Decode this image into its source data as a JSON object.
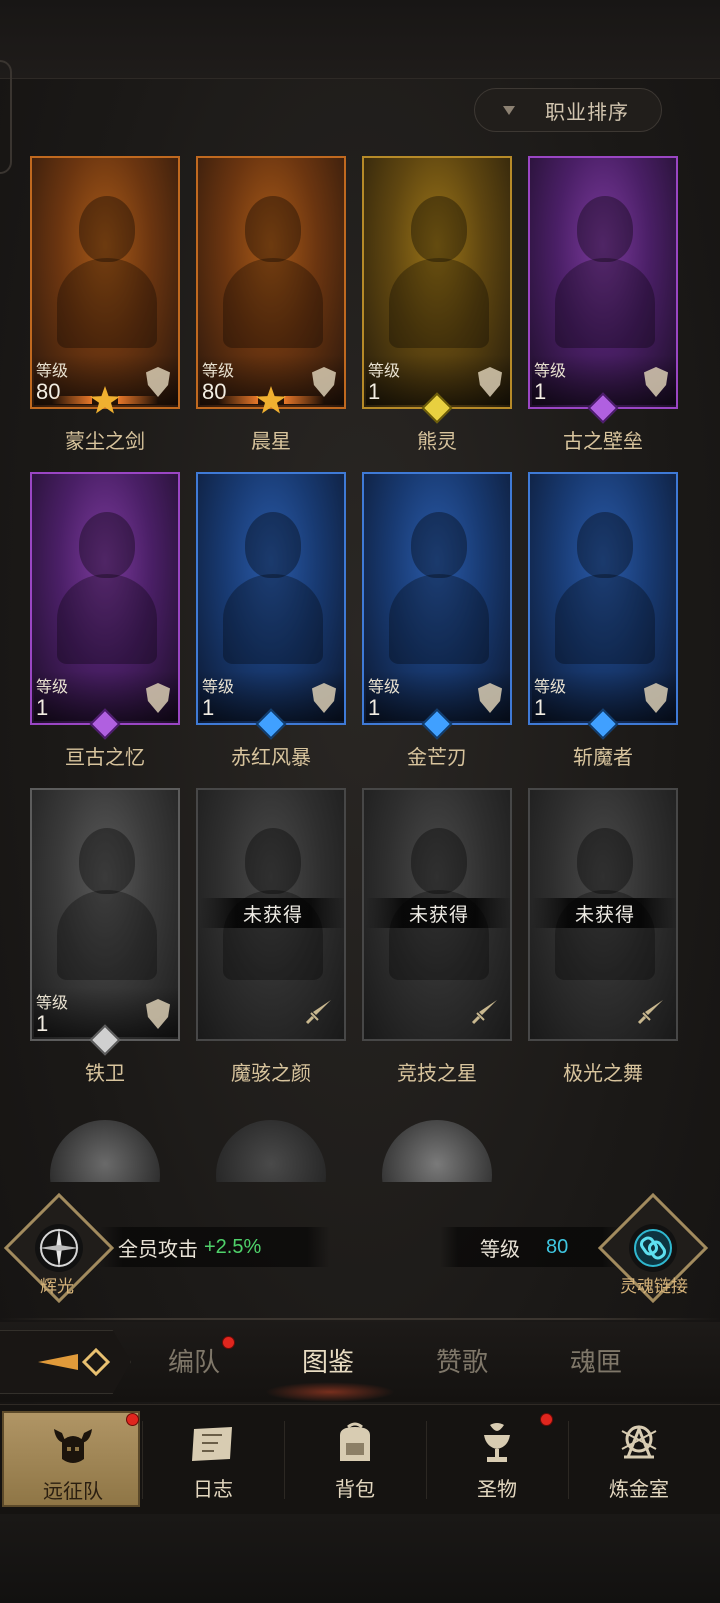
{
  "sort_button": {
    "label": "职业排序"
  },
  "heroes": [
    {
      "name": "蒙尘之剑",
      "level_label": "等级",
      "level": "80",
      "rarity": "orange",
      "status": "owned",
      "marker": "star"
    },
    {
      "name": "晨星",
      "level_label": "等级",
      "level": "80",
      "rarity": "orange",
      "status": "owned",
      "marker": "star"
    },
    {
      "name": "熊灵",
      "level_label": "等级",
      "level": "1",
      "rarity": "gold",
      "status": "owned",
      "marker": "gem"
    },
    {
      "name": "古之壁垒",
      "level_label": "等级",
      "level": "1",
      "rarity": "purple",
      "status": "owned",
      "marker": "gem"
    },
    {
      "name": "亘古之忆",
      "level_label": "等级",
      "level": "1",
      "rarity": "purple",
      "status": "owned",
      "marker": "gem"
    },
    {
      "name": "赤红风暴",
      "level_label": "等级",
      "level": "1",
      "rarity": "blue",
      "status": "owned",
      "marker": "gem"
    },
    {
      "name": "金芒刃",
      "level_label": "等级",
      "level": "1",
      "rarity": "blue",
      "status": "owned",
      "marker": "gem"
    },
    {
      "name": "斩魔者",
      "level_label": "等级",
      "level": "1",
      "rarity": "blue",
      "status": "owned",
      "marker": "gem"
    },
    {
      "name": "铁卫",
      "level_label": "等级",
      "level": "1",
      "rarity": "grey",
      "status": "owned",
      "marker": "gem"
    },
    {
      "name": "魔骇之颜",
      "status_label": "未获得",
      "rarity": "locked",
      "status": "locked"
    },
    {
      "name": "竞技之星",
      "status_label": "未获得",
      "rarity": "locked",
      "status": "locked"
    },
    {
      "name": "极光之舞",
      "status_label": "未获得",
      "rarity": "locked",
      "status": "locked"
    }
  ],
  "stats": {
    "left_badge": {
      "caption": "辉光",
      "icon": "compass-icon"
    },
    "bonus_label": "全员攻击",
    "bonus_value": "+2.5%",
    "level_label": "等级",
    "level_value": "80",
    "right_badge": {
      "caption": "灵魂链接",
      "icon": "chain-link-icon"
    }
  },
  "tabs": {
    "items": [
      {
        "label": "编队",
        "active": false,
        "has_dot": true
      },
      {
        "label": "图鉴",
        "active": true,
        "has_dot": false
      },
      {
        "label": "赞歌",
        "active": false,
        "has_dot": false
      },
      {
        "label": "魂匣",
        "active": false,
        "has_dot": false
      }
    ]
  },
  "bottom_nav": {
    "items": [
      {
        "label": "远征队",
        "icon": "horned-helmet-icon",
        "active": true,
        "has_dot": true
      },
      {
        "label": "日志",
        "icon": "scroll-map-icon",
        "active": false,
        "has_dot": false
      },
      {
        "label": "背包",
        "icon": "backpack-icon",
        "active": false,
        "has_dot": false
      },
      {
        "label": "圣物",
        "icon": "chalice-icon",
        "active": false,
        "has_dot": true
      },
      {
        "label": "炼金室",
        "icon": "alchemy-icon",
        "active": false,
        "has_dot": false
      }
    ]
  },
  "colors": {
    "accent_gold": "#d8c49d",
    "bonus_green": "#4fd26a",
    "level_cyan": "#3fc6e0",
    "notify_red": "#e0261e"
  }
}
